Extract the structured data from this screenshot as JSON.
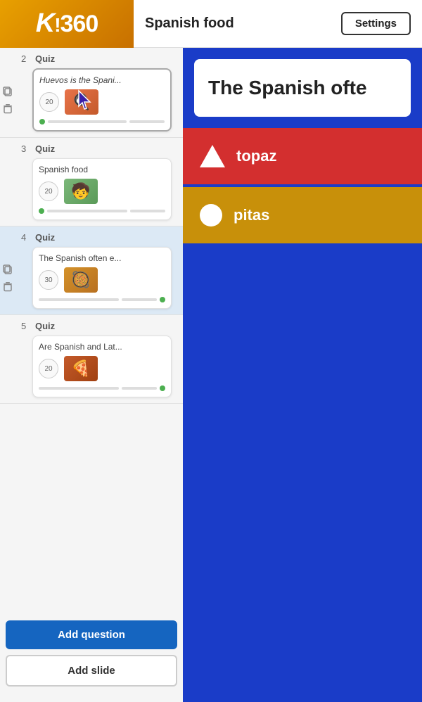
{
  "header": {
    "logo": "K!360",
    "title": "Spanish food",
    "settings_label": "Settings"
  },
  "sidebar": {
    "items": [
      {
        "number": "2",
        "type": "Quiz",
        "title": "Huevos is the Spani...",
        "title_italic": true,
        "points": "20",
        "selected": true,
        "active": false
      },
      {
        "number": "3",
        "type": "Quiz",
        "title": "Spanish food",
        "title_italic": false,
        "points": "20",
        "selected": false,
        "active": false
      },
      {
        "number": "4",
        "type": "Quiz",
        "title": "The Spanish often e...",
        "title_italic": false,
        "points": "30",
        "selected": false,
        "active": true
      },
      {
        "number": "5",
        "type": "Quiz",
        "title": "Are Spanish and Lat...",
        "title_italic": false,
        "points": "20",
        "selected": false,
        "active": false
      }
    ],
    "add_question_label": "Add question",
    "add_slide_label": "Add slide"
  },
  "preview": {
    "question_text": "The Spanish ofte",
    "answers": [
      {
        "shape": "triangle",
        "text": "topaz",
        "color": "red"
      },
      {
        "shape": "circle",
        "text": "pitas",
        "color": "yellow"
      }
    ]
  },
  "icons": {
    "copy": "⧉",
    "trash": "🗑"
  }
}
